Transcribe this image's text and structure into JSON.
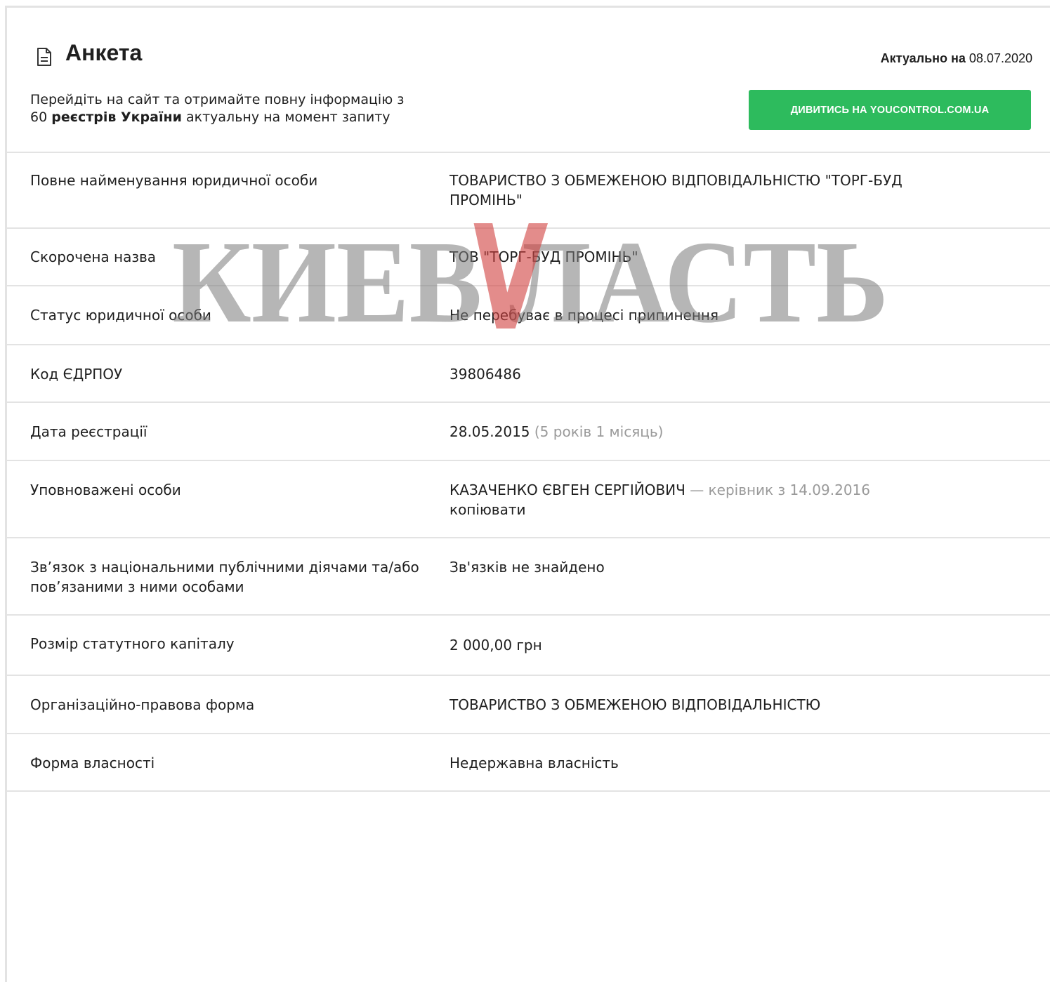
{
  "header": {
    "title": "Анкета",
    "actual_label": "Актуально на",
    "actual_date": "08.07.2020",
    "promo_line1": "Перейдіть на сайт та отримайте повну інформацію з",
    "promo_count": "60",
    "promo_bold": "реєстрів України",
    "promo_rest": "актуальну на момент запиту",
    "cta_label": "ДИВИТИСЬ НА YOUCONTROL.COM.UA"
  },
  "watermark": "КИЕВ\\ЛАСТЬ",
  "rows": {
    "full_name": {
      "label": "Повне найменування юридичної особи",
      "value": "ТОВАРИСТВО З ОБМЕЖЕНОЮ ВІДПОВІДАЛЬНІСТЮ \"ТОРГ-БУД ПРОМІНЬ\""
    },
    "short_name": {
      "label": "Скорочена назва",
      "value": "ТОВ \"ТОРГ-БУД ПРОМІНЬ\""
    },
    "status": {
      "label": "Статус юридичної особи",
      "value": "Не перебуває в процесі припинення"
    },
    "edrpou": {
      "label": "Код ЄДРПОУ",
      "value": "39806486"
    },
    "reg_date": {
      "label": "Дата реєстрації",
      "value": "28.05.2015",
      "note": "(5 років 1 місяць)"
    },
    "authorized": {
      "label": "Уповноважені особи",
      "value": "КАЗАЧЕНКО ЄВГЕН СЕРГІЙОВИЧ",
      "note": "— керівник з 14.09.2016",
      "copy": "копіювати"
    },
    "pep": {
      "label": "Зв’язок з національними публічними діячами та/або пов’язаними з ними особами",
      "value": "Зв'язків не знайдено"
    },
    "capital": {
      "label": "Розмір статутного капіталу",
      "value": "2 000,00 грн"
    },
    "legal_form": {
      "label": "Організаційно-правова форма",
      "value": "ТОВАРИСТВО З ОБМЕЖЕНОЮ ВІДПОВІДАЛЬНІСТЮ"
    },
    "ownership": {
      "label": "Форма власності",
      "value": "Недержавна власність"
    }
  }
}
